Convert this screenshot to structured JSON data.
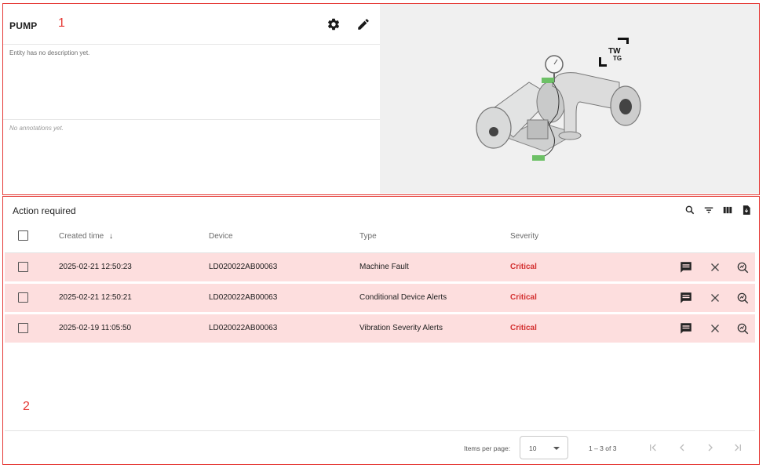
{
  "entity": {
    "title": "PUMP",
    "description": "Entity has no description yet.",
    "annotations": "No annotations yet.",
    "image_logo_text_top": "TW",
    "image_logo_text_bottom": "TG"
  },
  "annotations": {
    "panel1": "1",
    "panel2": "2"
  },
  "table": {
    "title": "Action required",
    "columns": {
      "created": "Created time",
      "sort_arrow": "↓",
      "device": "Device",
      "type": "Type",
      "severity": "Severity"
    },
    "rows": [
      {
        "created": "2025-02-21 12:50:23",
        "device": "LD020022AB00063",
        "type": "Machine Fault",
        "severity": "Critical"
      },
      {
        "created": "2025-02-21 12:50:21",
        "device": "LD020022AB00063",
        "type": "Conditional Device Alerts",
        "severity": "Critical"
      },
      {
        "created": "2025-02-19 11:05:50",
        "device": "LD020022AB00063",
        "type": "Vibration Severity Alerts",
        "severity": "Critical"
      }
    ],
    "toolbar_icons": [
      "search-icon",
      "filter-icon",
      "columns-icon",
      "export-icon"
    ],
    "row_action_icons": [
      "comment-icon",
      "clear-icon",
      "alarm-details-icon"
    ]
  },
  "pagination": {
    "items_per_page_label": "Items per page:",
    "items_per_page_value": "10",
    "range": "1 – 3 of 3"
  },
  "colors": {
    "annotation_border": "#e53935",
    "critical_row_bg": "#fddede",
    "critical_text": "#d32f2f",
    "image_bg": "#f0f0f0"
  }
}
